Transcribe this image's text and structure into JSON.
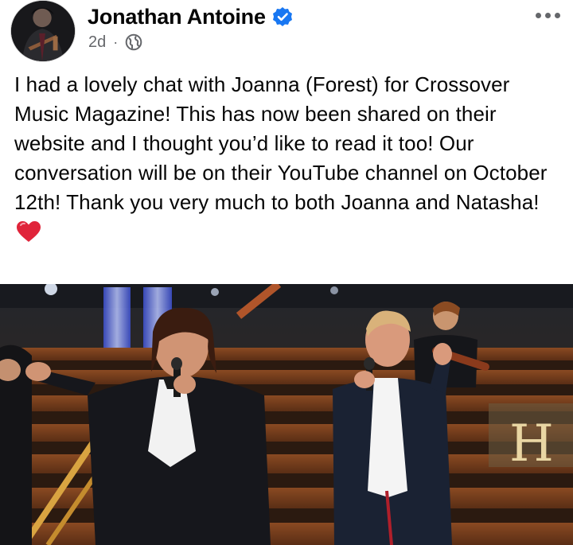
{
  "post": {
    "author": "Jonathan Antoine",
    "timestamp": "2d",
    "separator": "·",
    "audience_icon": "globe-icon",
    "verified_icon": "verified-badge-icon",
    "more_icon": "more-options-icon",
    "text": "I had a lovely chat with Joanna (Forest) for Crossover Music Magazine! This has now been shared on their website and I thought you’d like to read it too! Our conversation will be on their YouTube channel on October 12th! Thank you very much  to both Joanna and Natasha!",
    "emoji_icon": "red-heart-icon",
    "photo_sign_text": "H"
  },
  "colors": {
    "verified_blue": "#1877f2",
    "meta_gray": "#65676b",
    "heart_red": "#e0243a"
  }
}
